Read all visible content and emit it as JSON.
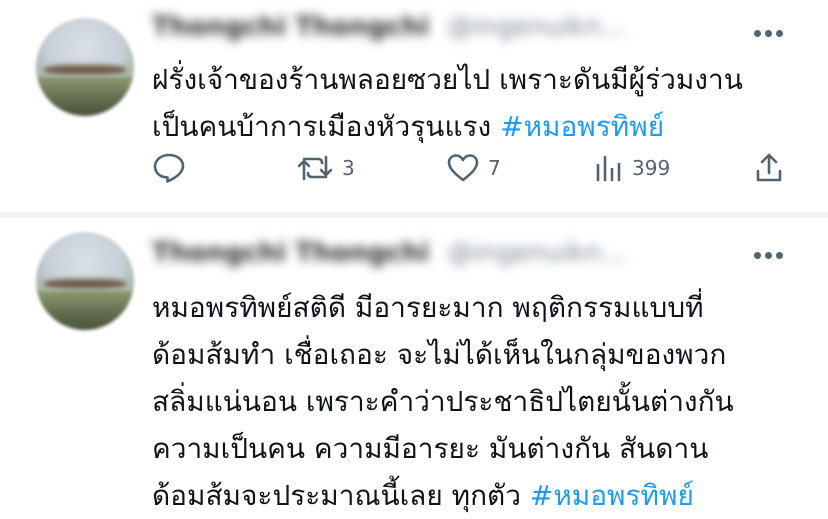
{
  "tweets": [
    {
      "author_name": "Thongchi Thongchi",
      "author_handle": "@ingenuikn...",
      "text_lines": [
        "ฝรั่งเจ้าของร้านพลอยซวยไป เพราะดันมีผู้ร่วมงาน",
        "เป็นคนบ้าการเมืองหัวรุนแรง "
      ],
      "hashtag": "#หมอพรทิพย์",
      "stats": {
        "retweets": "3",
        "likes": "7",
        "views": "399"
      }
    },
    {
      "author_name": "Thongchi Thongchi",
      "author_handle": "@ingenuikn...",
      "text_lines": [
        "หมอพรทิพย์สติดี มีอารยะมาก พฤติกรรมแบบที่",
        "ด้อมส้มทำ เชื่อเถอะ จะไม่ได้เห็นในกลุ่มของพวก",
        "สลิ่มแน่นอน เพราะคำว่าประชาธิปไตยนั้นต่างกัน",
        "ความเป็นคน ความมีอารยะ มันต่างกัน สันดาน",
        "ด้อมส้มจะประมาณนี้เลย ทุกตัว "
      ],
      "hashtag": "#หมอพรทิพย์"
    }
  ],
  "colors": {
    "text": "#0f1419",
    "hashtag": "#1d9bf0",
    "icon": "#536471",
    "divider": "#f2f3f4"
  },
  "icons": [
    "reply-icon",
    "retweet-icon",
    "like-icon",
    "views-icon",
    "share-icon",
    "more-icon"
  ]
}
